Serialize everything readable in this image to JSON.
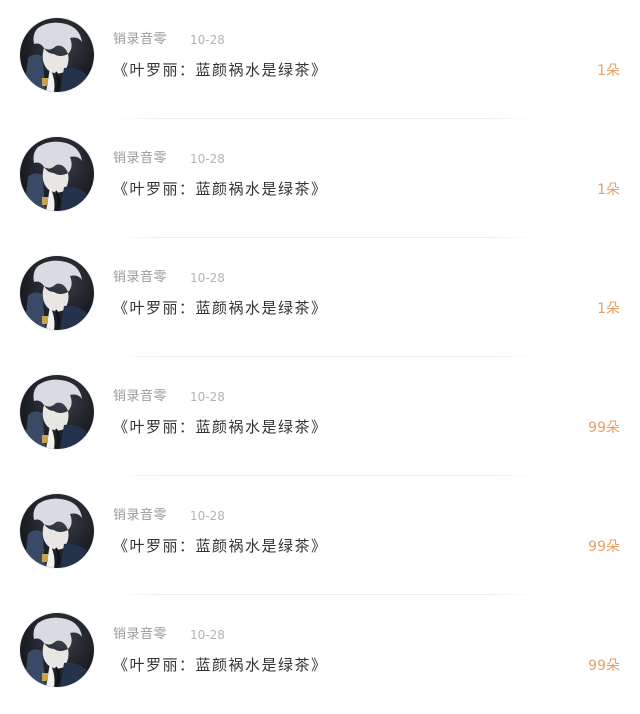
{
  "items": [
    {
      "username": "销录音零",
      "date": "10-28",
      "gift": "《叶罗丽：蓝颜祸水是绿茶》",
      "count": "1朵"
    },
    {
      "username": "销录音零",
      "date": "10-28",
      "gift": "《叶罗丽：蓝颜祸水是绿茶》",
      "count": "1朵"
    },
    {
      "username": "销录音零",
      "date": "10-28",
      "gift": "《叶罗丽：蓝颜祸水是绿茶》",
      "count": "1朵"
    },
    {
      "username": "销录音零",
      "date": "10-28",
      "gift": "《叶罗丽：蓝颜祸水是绿茶》",
      "count": "99朵"
    },
    {
      "username": "销录音零",
      "date": "10-28",
      "gift": "《叶罗丽：蓝颜祸水是绿茶》",
      "count": "99朵"
    },
    {
      "username": "销录音零",
      "date": "10-28",
      "gift": "《叶罗丽：蓝颜祸水是绿茶》",
      "count": "99朵"
    }
  ],
  "colors": {
    "username": "#9b9b9b",
    "date": "#b4b4b4",
    "title": "#333333",
    "count_accent": "#e8a064"
  },
  "icons": {
    "avatar": "anime-character-avatar"
  }
}
